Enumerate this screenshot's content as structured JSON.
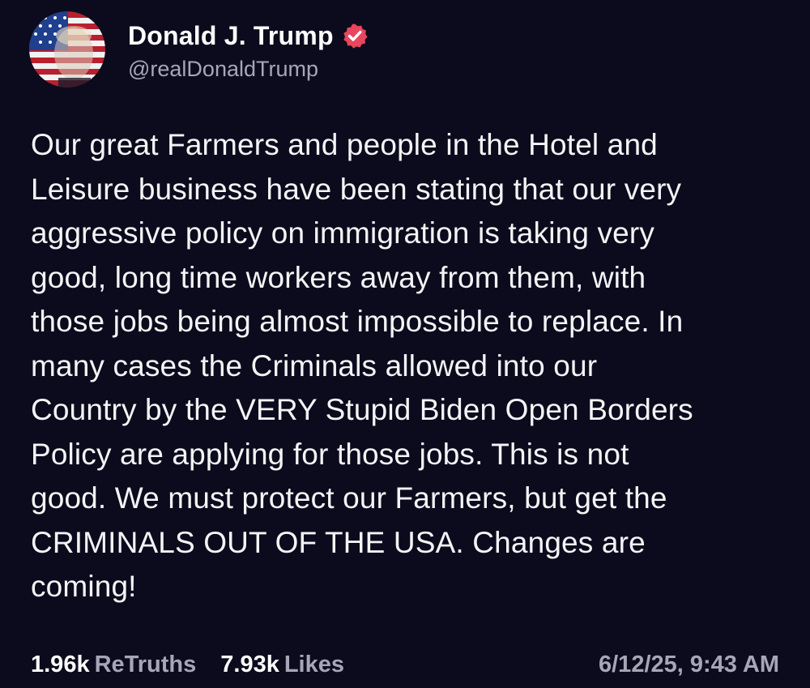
{
  "author": {
    "display_name": "Donald J. Trump",
    "handle": "@realDonaldTrump",
    "verified_icon": "verified-badge-icon",
    "verified_color": "#e8465d",
    "avatar_icon": "profile-avatar-flag-portrait"
  },
  "post": {
    "lines": [
      "Our great Farmers and people in the Hotel and",
      "Leisure business have been stating that our very",
      "aggressive policy on immigration is taking very",
      "good, long time workers away from them, with",
      "those jobs being almost impossible to replace. In",
      "many cases the Criminals allowed into our",
      "Country by the VERY Stupid Biden Open Borders",
      "Policy are applying for those jobs. This is not",
      "good. We must protect our Farmers, but get the",
      "CRIMINALS OUT OF THE USA. Changes are",
      "coming!"
    ]
  },
  "stats": {
    "retruths_count": "1.96k",
    "retruths_label": "ReTruths",
    "likes_count": "7.93k",
    "likes_label": "Likes",
    "timestamp": "6/12/25, 9:43 AM"
  },
  "colors": {
    "background": "#0c0b1d",
    "secondary_text": "#a7a6b6",
    "primary_text": "#ffffff"
  }
}
